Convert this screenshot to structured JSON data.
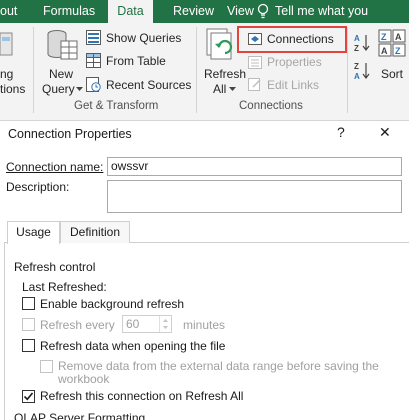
{
  "ribbon": {
    "tabs": [
      {
        "label": "out",
        "active": false
      },
      {
        "label": "Formulas",
        "active": false
      },
      {
        "label": "Data",
        "active": true
      },
      {
        "label": "Review",
        "active": false
      },
      {
        "label": "View",
        "active": false
      }
    ],
    "tell_me": "Tell me what you",
    "get_transform": {
      "left_partial": [
        "ng",
        "tions"
      ],
      "new_query": [
        "New",
        "Query"
      ],
      "show_queries": "Show Queries",
      "from_table": "From Table",
      "recent_sources": "Recent Sources",
      "group_label": "Get & Transform"
    },
    "connections": {
      "refresh_all": [
        "Refresh",
        "All"
      ],
      "connections": "Connections",
      "properties": "Properties",
      "edit_links": "Edit Links",
      "group_label": "Connections"
    },
    "sort": {
      "sort_label": "Sort"
    },
    "colors": {
      "ribbon_green": "#217346",
      "highlight": "#e0453e"
    }
  },
  "dialog": {
    "title": "Connection Properties",
    "help": "?",
    "close": "✕",
    "connection_name_label": "Connection name:",
    "connection_name_value": "owssvr",
    "description_label": "Description:",
    "description_value": "",
    "tabs": [
      {
        "label": "Usage",
        "active": true
      },
      {
        "label": "Definition",
        "active": false
      }
    ],
    "refresh_control_label": "Refresh control",
    "last_refreshed_label": "Last Refreshed:",
    "options": {
      "background_refresh": {
        "label": "Enable background refresh",
        "checked": false,
        "disabled": false
      },
      "refresh_every": {
        "label": "Refresh every",
        "checked": false,
        "disabled": true,
        "value": "60",
        "unit": "minutes"
      },
      "refresh_on_open": {
        "label": "Refresh data when opening the file",
        "checked": false,
        "disabled": false
      },
      "remove_data": {
        "label_line1": "Remove data from the external data range before saving the",
        "label_line2": "workbook",
        "checked": false,
        "disabled": true
      },
      "refresh_all": {
        "label": "Refresh this connection on Refresh All",
        "checked": true,
        "disabled": false
      }
    },
    "olap_label": "OLAP Server Formatting"
  }
}
